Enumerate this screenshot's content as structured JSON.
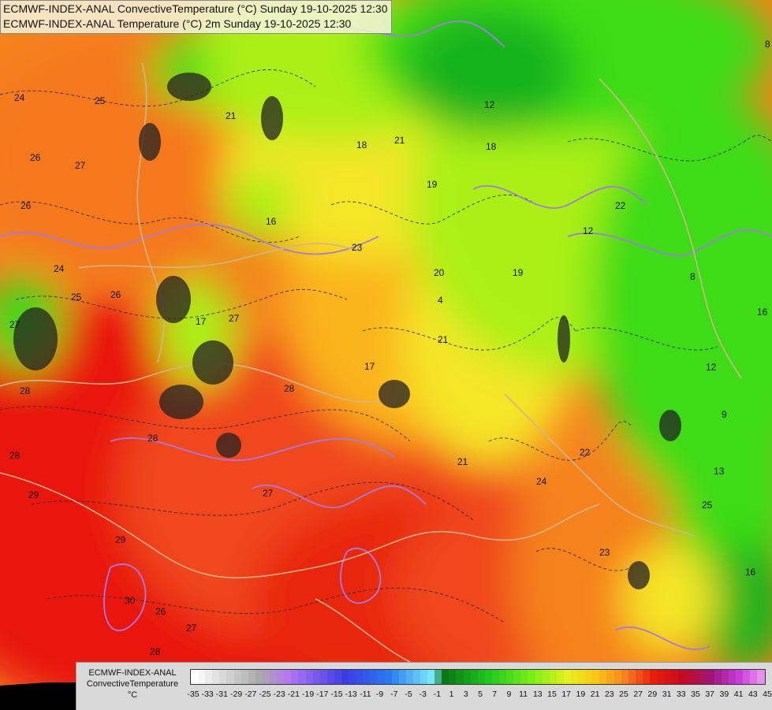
{
  "header": {
    "line1": "ECMWF-INDEX-ANAL ConvectiveTemperature (°C) Sunday 19-10-2025 12:30",
    "line2": "ECMWF-INDEX-ANAL Temperature (°C) 2m Sunday 19-10-2025 12:30"
  },
  "legend": {
    "title_line1": "ECMWF-INDEX-ANAL",
    "title_line2": "ConvectiveTemperature",
    "unit": "°C",
    "tick_labels": [
      "-35",
      "-33",
      "-31",
      "-29",
      "-27",
      "-25",
      "-23",
      "-21",
      "-19",
      "-17",
      "-15",
      "-13",
      "-11",
      "-9",
      "-7",
      "-5",
      "-3",
      "-1",
      "1",
      "3",
      "5",
      "7",
      "9",
      "11",
      "13",
      "15",
      "17",
      "19",
      "21",
      "23",
      "25",
      "27",
      "29",
      "31",
      "33",
      "35",
      "37",
      "39",
      "41",
      "43",
      "45"
    ]
  },
  "contour_labels": [
    "24",
    "25",
    "26",
    "27",
    "26",
    "24",
    "25",
    "26",
    "27",
    "28",
    "29",
    "28",
    "29",
    "30",
    "26",
    "27",
    "28",
    "27",
    "27",
    "28",
    "28",
    "17",
    "17",
    "16",
    "21",
    "18",
    "19",
    "21",
    "22",
    "23",
    "24",
    "22",
    "12",
    "12",
    "13",
    "16",
    "18",
    "19",
    "20",
    "21",
    "25",
    "16",
    "12",
    "8",
    "8",
    "9",
    "4",
    "23",
    "21"
  ],
  "colors": {
    "hot_red": "#e8140a",
    "red_orange": "#f0461e",
    "orange": "#f5821e",
    "yellow_orange": "#fab41e",
    "yellow": "#f5e628",
    "yellow_green": "#aaf014",
    "green": "#3cdc14",
    "deep_green": "#14b41e",
    "contour_purple": "#a678e6",
    "border_tan": "#d2b48c"
  }
}
